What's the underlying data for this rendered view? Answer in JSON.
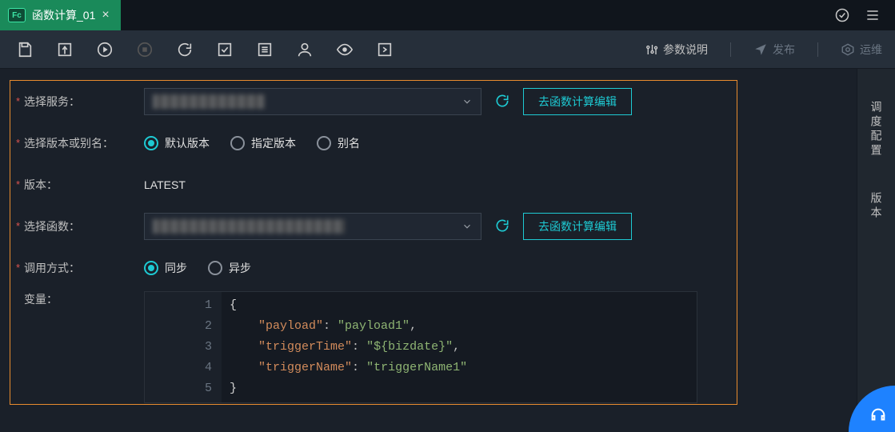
{
  "tab": {
    "badge": "Fc",
    "title": "函数计算_01",
    "close": "×"
  },
  "topbar": {
    "sync_icon": "sync",
    "menu_icon": "menu"
  },
  "toolbar": {
    "right": {
      "params_label": "参数说明",
      "publish_label": "发布",
      "ops_label": "运维"
    }
  },
  "side": {
    "schedule": "调度配置",
    "version": "版本"
  },
  "form": {
    "service": {
      "label": "选择服务：",
      "edit_btn": "去函数计算编辑"
    },
    "version_select": {
      "label": "选择版本或别名：",
      "opts": {
        "default": "默认版本",
        "specific": "指定版本",
        "alias": "别名"
      }
    },
    "version": {
      "label": "版本：",
      "value": "LATEST"
    },
    "func": {
      "label": "选择函数：",
      "edit_btn": "去函数计算编辑"
    },
    "invoke": {
      "label": "调用方式：",
      "opts": {
        "sync": "同步",
        "async": "异步"
      }
    },
    "vars": {
      "label": "变量："
    }
  },
  "editor": {
    "lines": [
      "1",
      "2",
      "3",
      "4",
      "5"
    ],
    "kv": {
      "payload_key": "\"payload\"",
      "payload_val": "\"payload1\"",
      "trigTime_key": "\"triggerTime\"",
      "trigTime_val": "\"${bizdate}\"",
      "trigName_key": "\"triggerName\"",
      "trigName_val": "\"triggerName1\""
    }
  }
}
